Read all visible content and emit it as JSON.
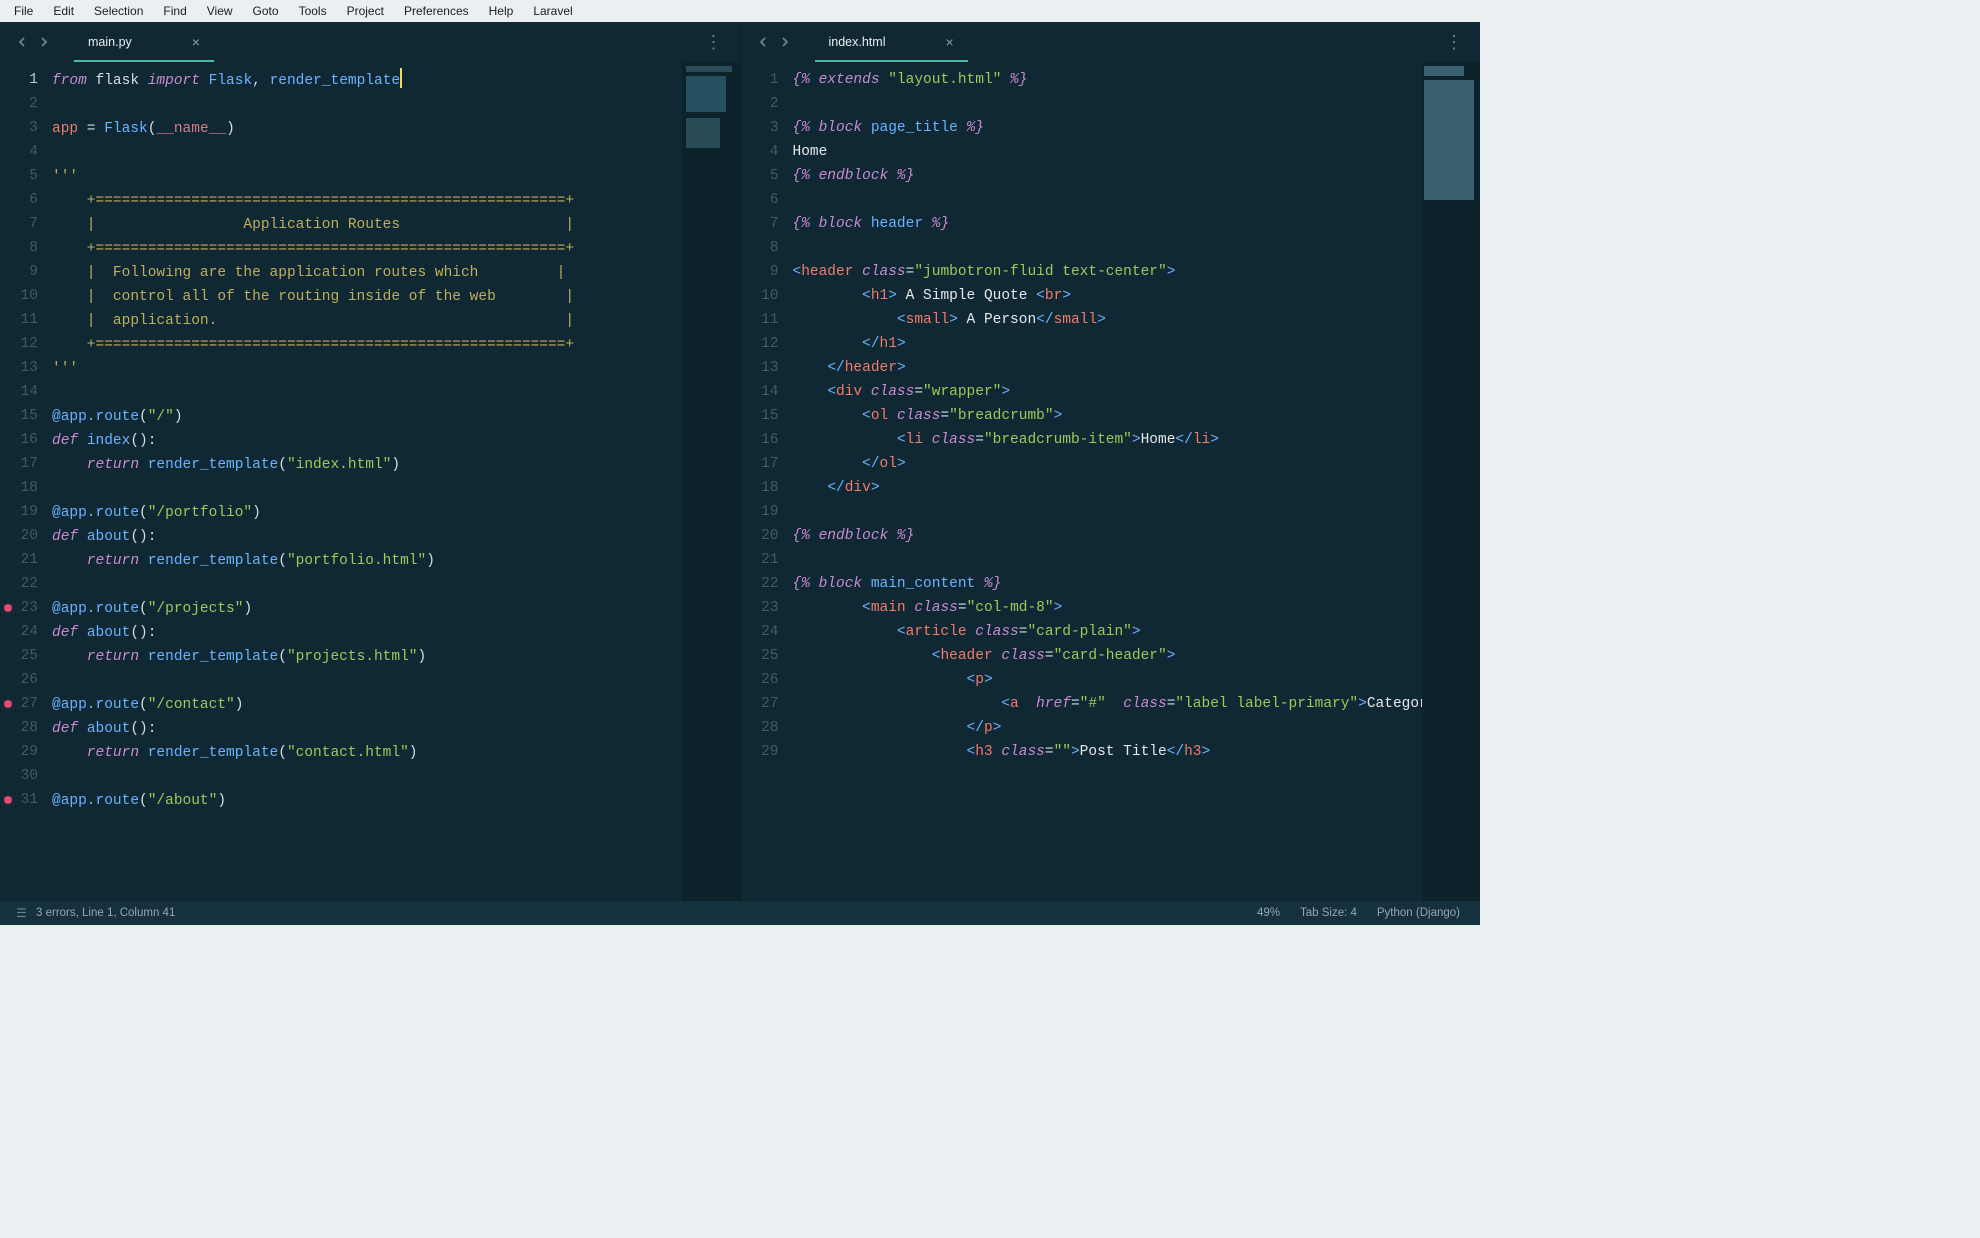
{
  "menubar": [
    "File",
    "Edit",
    "Selection",
    "Find",
    "View",
    "Goto",
    "Tools",
    "Project",
    "Preferences",
    "Help",
    "Laravel"
  ],
  "left": {
    "tab": {
      "label": "main.py"
    },
    "lines": 31,
    "cursor_line": 1,
    "bp_lines": [
      23,
      27,
      31
    ],
    "code": [
      [
        {
          "c": "kw-it",
          "t": "from"
        },
        {
          "t": " "
        },
        {
          "c": "id",
          "t": "flask"
        },
        {
          "t": " "
        },
        {
          "c": "kw-it",
          "t": "import"
        },
        {
          "t": " "
        },
        {
          "c": "kw-blue",
          "t": "Flask"
        },
        {
          "c": "id",
          "t": ", "
        },
        {
          "c": "fn",
          "t": "render_template"
        },
        {
          "cursor": true
        }
      ],
      [],
      [
        {
          "c": "var",
          "t": "app"
        },
        {
          "c": "id",
          "t": " = "
        },
        {
          "c": "kw-blue",
          "t": "Flask"
        },
        {
          "c": "id",
          "t": "("
        },
        {
          "c": "const",
          "t": "__name__"
        },
        {
          "c": "id",
          "t": ")"
        }
      ],
      [],
      [
        {
          "c": "cmt",
          "t": "'''"
        }
      ],
      [
        {
          "c": "cmt",
          "t": "    +======================================================+"
        }
      ],
      [
        {
          "c": "cmt",
          "t": "    |                 Application Routes                   |"
        }
      ],
      [
        {
          "c": "cmt",
          "t": "    +======================================================+"
        }
      ],
      [
        {
          "c": "cmt",
          "t": "    |  Following are the application routes which         |"
        }
      ],
      [
        {
          "c": "cmt",
          "t": "    |  control all of the routing inside of the web        |"
        }
      ],
      [
        {
          "c": "cmt",
          "t": "    |  application.                                        |"
        }
      ],
      [
        {
          "c": "cmt",
          "t": "    +======================================================+"
        }
      ],
      [
        {
          "c": "cmt",
          "t": "'''"
        }
      ],
      [],
      [
        {
          "c": "fn",
          "t": "@app.route"
        },
        {
          "c": "id",
          "t": "("
        },
        {
          "c": "str",
          "t": "\"/\""
        },
        {
          "c": "id",
          "t": ")"
        }
      ],
      [
        {
          "c": "kw-it",
          "t": "def"
        },
        {
          "t": " "
        },
        {
          "c": "fn",
          "t": "index"
        },
        {
          "c": "id",
          "t": "():"
        }
      ],
      [
        {
          "c": "kw-it",
          "t": "    return"
        },
        {
          "t": " "
        },
        {
          "c": "fn",
          "t": "render_template"
        },
        {
          "c": "id",
          "t": "("
        },
        {
          "c": "str",
          "t": "\"index.html\""
        },
        {
          "c": "id",
          "t": ")"
        }
      ],
      [],
      [
        {
          "c": "fn",
          "t": "@app.route"
        },
        {
          "c": "id",
          "t": "("
        },
        {
          "c": "str",
          "t": "\"/portfolio\""
        },
        {
          "c": "id",
          "t": ")"
        }
      ],
      [
        {
          "c": "kw-it",
          "t": "def"
        },
        {
          "t": " "
        },
        {
          "c": "fn",
          "t": "about"
        },
        {
          "c": "id",
          "t": "():"
        }
      ],
      [
        {
          "c": "kw-it",
          "t": "    return"
        },
        {
          "t": " "
        },
        {
          "c": "fn",
          "t": "render_template"
        },
        {
          "c": "id",
          "t": "("
        },
        {
          "c": "str",
          "t": "\"portfolio.html\""
        },
        {
          "c": "id",
          "t": ")"
        }
      ],
      [],
      [
        {
          "c": "fn",
          "t": "@app.route"
        },
        {
          "c": "id",
          "t": "("
        },
        {
          "c": "str",
          "t": "\"/projects\""
        },
        {
          "c": "id",
          "t": ")"
        }
      ],
      [
        {
          "c": "kw-it",
          "t": "def"
        },
        {
          "t": " "
        },
        {
          "c": "fn",
          "t": "about"
        },
        {
          "c": "id",
          "t": "():"
        }
      ],
      [
        {
          "c": "kw-it",
          "t": "    return"
        },
        {
          "t": " "
        },
        {
          "c": "fn",
          "t": "render_template"
        },
        {
          "c": "id",
          "t": "("
        },
        {
          "c": "str",
          "t": "\"projects.html\""
        },
        {
          "c": "id",
          "t": ")"
        }
      ],
      [],
      [
        {
          "c": "fn",
          "t": "@app.route"
        },
        {
          "c": "id",
          "t": "("
        },
        {
          "c": "str",
          "t": "\"/contact\""
        },
        {
          "c": "id",
          "t": ")"
        }
      ],
      [
        {
          "c": "kw-it",
          "t": "def"
        },
        {
          "t": " "
        },
        {
          "c": "fn",
          "t": "about"
        },
        {
          "c": "id",
          "t": "():"
        }
      ],
      [
        {
          "c": "kw-it",
          "t": "    return"
        },
        {
          "t": " "
        },
        {
          "c": "fn",
          "t": "render_template"
        },
        {
          "c": "id",
          "t": "("
        },
        {
          "c": "str",
          "t": "\"contact.html\""
        },
        {
          "c": "id",
          "t": ")"
        }
      ],
      [],
      [
        {
          "c": "fn",
          "t": "@app.route"
        },
        {
          "c": "id",
          "t": "("
        },
        {
          "c": "str",
          "t": "\"/about\""
        },
        {
          "c": "id",
          "t": ")"
        }
      ]
    ]
  },
  "right": {
    "tab": {
      "label": "index.html"
    },
    "lines": 29,
    "code": [
      [
        {
          "c": "jj",
          "t": "{% "
        },
        {
          "c": "jj-kw",
          "t": "extends"
        },
        {
          "t": " "
        },
        {
          "c": "str",
          "t": "\"layout.html\""
        },
        {
          "c": "jj",
          "t": " %}"
        }
      ],
      [],
      [
        {
          "c": "jj",
          "t": "{% "
        },
        {
          "c": "jj-kw",
          "t": "block"
        },
        {
          "t": " "
        },
        {
          "c": "jj-name",
          "t": "page_title"
        },
        {
          "c": "jj",
          "t": " %}"
        }
      ],
      [
        {
          "c": "txt",
          "t": "Home"
        }
      ],
      [
        {
          "c": "jj",
          "t": "{% "
        },
        {
          "c": "jj-kw",
          "t": "endblock"
        },
        {
          "c": "jj",
          "t": " %}"
        }
      ],
      [],
      [
        {
          "c": "jj",
          "t": "{% "
        },
        {
          "c": "jj-kw",
          "t": "block"
        },
        {
          "t": " "
        },
        {
          "c": "jj-name",
          "t": "header"
        },
        {
          "c": "jj",
          "t": " %}"
        }
      ],
      [],
      [
        {
          "c": "tagang",
          "t": "<"
        },
        {
          "c": "tag",
          "t": "header"
        },
        {
          "t": " "
        },
        {
          "c": "attr",
          "t": "class"
        },
        {
          "c": "id",
          "t": "="
        },
        {
          "c": "str",
          "t": "\"jumbotron-fluid text-center\""
        },
        {
          "c": "tagang",
          "t": ">"
        }
      ],
      [
        {
          "t": "        "
        },
        {
          "c": "tagang",
          "t": "<"
        },
        {
          "c": "tag",
          "t": "h1"
        },
        {
          "c": "tagang",
          "t": ">"
        },
        {
          "c": "txt",
          "t": " A Simple Quote "
        },
        {
          "c": "tagang",
          "t": "<"
        },
        {
          "c": "tag",
          "t": "br"
        },
        {
          "c": "tagang",
          "t": ">"
        }
      ],
      [
        {
          "t": "            "
        },
        {
          "c": "tagang",
          "t": "<"
        },
        {
          "c": "tag",
          "t": "small"
        },
        {
          "c": "tagang",
          "t": ">"
        },
        {
          "c": "txt",
          "t": " A Person"
        },
        {
          "c": "tagang",
          "t": "</"
        },
        {
          "c": "tag",
          "t": "small"
        },
        {
          "c": "tagang",
          "t": ">"
        }
      ],
      [
        {
          "t": "        "
        },
        {
          "c": "tagang",
          "t": "</"
        },
        {
          "c": "tag",
          "t": "h1"
        },
        {
          "c": "tagang",
          "t": ">"
        }
      ],
      [
        {
          "t": "    "
        },
        {
          "c": "tagang",
          "t": "</"
        },
        {
          "c": "tag",
          "t": "header"
        },
        {
          "c": "tagang",
          "t": ">"
        }
      ],
      [
        {
          "t": "    "
        },
        {
          "c": "tagang",
          "t": "<"
        },
        {
          "c": "tag",
          "t": "div"
        },
        {
          "t": " "
        },
        {
          "c": "attr",
          "t": "class"
        },
        {
          "c": "id",
          "t": "="
        },
        {
          "c": "str",
          "t": "\"wrapper\""
        },
        {
          "c": "tagang",
          "t": ">"
        }
      ],
      [
        {
          "t": "        "
        },
        {
          "c": "tagang",
          "t": "<"
        },
        {
          "c": "tag",
          "t": "ol"
        },
        {
          "t": " "
        },
        {
          "c": "attr",
          "t": "class"
        },
        {
          "c": "id",
          "t": "="
        },
        {
          "c": "str",
          "t": "\"breadcrumb\""
        },
        {
          "c": "tagang",
          "t": ">"
        }
      ],
      [
        {
          "t": "            "
        },
        {
          "c": "tagang",
          "t": "<"
        },
        {
          "c": "tag",
          "t": "li"
        },
        {
          "t": " "
        },
        {
          "c": "attr",
          "t": "class"
        },
        {
          "c": "id",
          "t": "="
        },
        {
          "c": "str",
          "t": "\"breadcrumb-item\""
        },
        {
          "c": "tagang",
          "t": ">"
        },
        {
          "c": "txt",
          "t": "Home"
        },
        {
          "c": "tagang",
          "t": "</"
        },
        {
          "c": "tag",
          "t": "li"
        },
        {
          "c": "tagang",
          "t": ">"
        }
      ],
      [
        {
          "t": "        "
        },
        {
          "c": "tagang",
          "t": "</"
        },
        {
          "c": "tag",
          "t": "ol"
        },
        {
          "c": "tagang",
          "t": ">"
        }
      ],
      [
        {
          "t": "    "
        },
        {
          "c": "tagang",
          "t": "</"
        },
        {
          "c": "tag",
          "t": "div"
        },
        {
          "c": "tagang",
          "t": ">"
        }
      ],
      [],
      [
        {
          "c": "jj",
          "t": "{% "
        },
        {
          "c": "jj-kw",
          "t": "endblock"
        },
        {
          "c": "jj",
          "t": " %}"
        }
      ],
      [],
      [
        {
          "c": "jj",
          "t": "{% "
        },
        {
          "c": "jj-kw",
          "t": "block"
        },
        {
          "t": " "
        },
        {
          "c": "jj-name",
          "t": "main_content"
        },
        {
          "c": "jj",
          "t": " %}"
        }
      ],
      [
        {
          "t": "        "
        },
        {
          "c": "tagang",
          "t": "<"
        },
        {
          "c": "tag",
          "t": "main"
        },
        {
          "t": " "
        },
        {
          "c": "attr",
          "t": "class"
        },
        {
          "c": "id",
          "t": "="
        },
        {
          "c": "str",
          "t": "\"col-md-8\""
        },
        {
          "c": "tagang",
          "t": ">"
        }
      ],
      [
        {
          "t": "            "
        },
        {
          "c": "tagang",
          "t": "<"
        },
        {
          "c": "tag",
          "t": "article"
        },
        {
          "t": " "
        },
        {
          "c": "attr",
          "t": "class"
        },
        {
          "c": "id",
          "t": "="
        },
        {
          "c": "str",
          "t": "\"card-plain\""
        },
        {
          "c": "tagang",
          "t": ">"
        }
      ],
      [
        {
          "t": "                "
        },
        {
          "c": "tagang",
          "t": "<"
        },
        {
          "c": "tag",
          "t": "header"
        },
        {
          "t": " "
        },
        {
          "c": "attr",
          "t": "class"
        },
        {
          "c": "id",
          "t": "="
        },
        {
          "c": "str",
          "t": "\"card-header\""
        },
        {
          "c": "tagang",
          "t": ">"
        }
      ],
      [
        {
          "t": "                    "
        },
        {
          "c": "tagang",
          "t": "<"
        },
        {
          "c": "tag",
          "t": "p"
        },
        {
          "c": "tagang",
          "t": ">"
        }
      ],
      [
        {
          "t": "                        "
        },
        {
          "c": "tagang",
          "t": "<"
        },
        {
          "c": "tag",
          "t": "a"
        },
        {
          "t": "  "
        },
        {
          "c": "attr",
          "t": "href"
        },
        {
          "c": "id",
          "t": "="
        },
        {
          "c": "str",
          "t": "\"#\""
        },
        {
          "t": "  "
        },
        {
          "c": "attr",
          "t": "class"
        },
        {
          "c": "id",
          "t": "="
        },
        {
          "c": "str",
          "t": "\"label label-primary\""
        },
        {
          "c": "tagang",
          "t": ">"
        },
        {
          "c": "txt",
          "t": "Category"
        },
        {
          "c": "tagang",
          "t": "</"
        },
        {
          "c": "tag",
          "t": "a"
        },
        {
          "c": "tagang",
          "t": ">"
        }
      ],
      [
        {
          "t": "                    "
        },
        {
          "c": "tagang",
          "t": "</"
        },
        {
          "c": "tag",
          "t": "p"
        },
        {
          "c": "tagang",
          "t": ">"
        }
      ],
      [
        {
          "t": "                    "
        },
        {
          "c": "tagang",
          "t": "<"
        },
        {
          "c": "tag",
          "t": "h3"
        },
        {
          "t": " "
        },
        {
          "c": "attr",
          "t": "class"
        },
        {
          "c": "id",
          "t": "="
        },
        {
          "c": "str",
          "t": "\"\""
        },
        {
          "c": "tagang",
          "t": ">"
        },
        {
          "c": "txt",
          "t": "Post Title"
        },
        {
          "c": "tagang",
          "t": "</"
        },
        {
          "c": "tag",
          "t": "h3"
        },
        {
          "c": "tagang",
          "t": ">"
        }
      ]
    ]
  },
  "status": {
    "left": "3 errors, Line 1, Column 41",
    "percent": "49%",
    "tab_size": "Tab Size: 4",
    "lang": "Python (Django)"
  }
}
